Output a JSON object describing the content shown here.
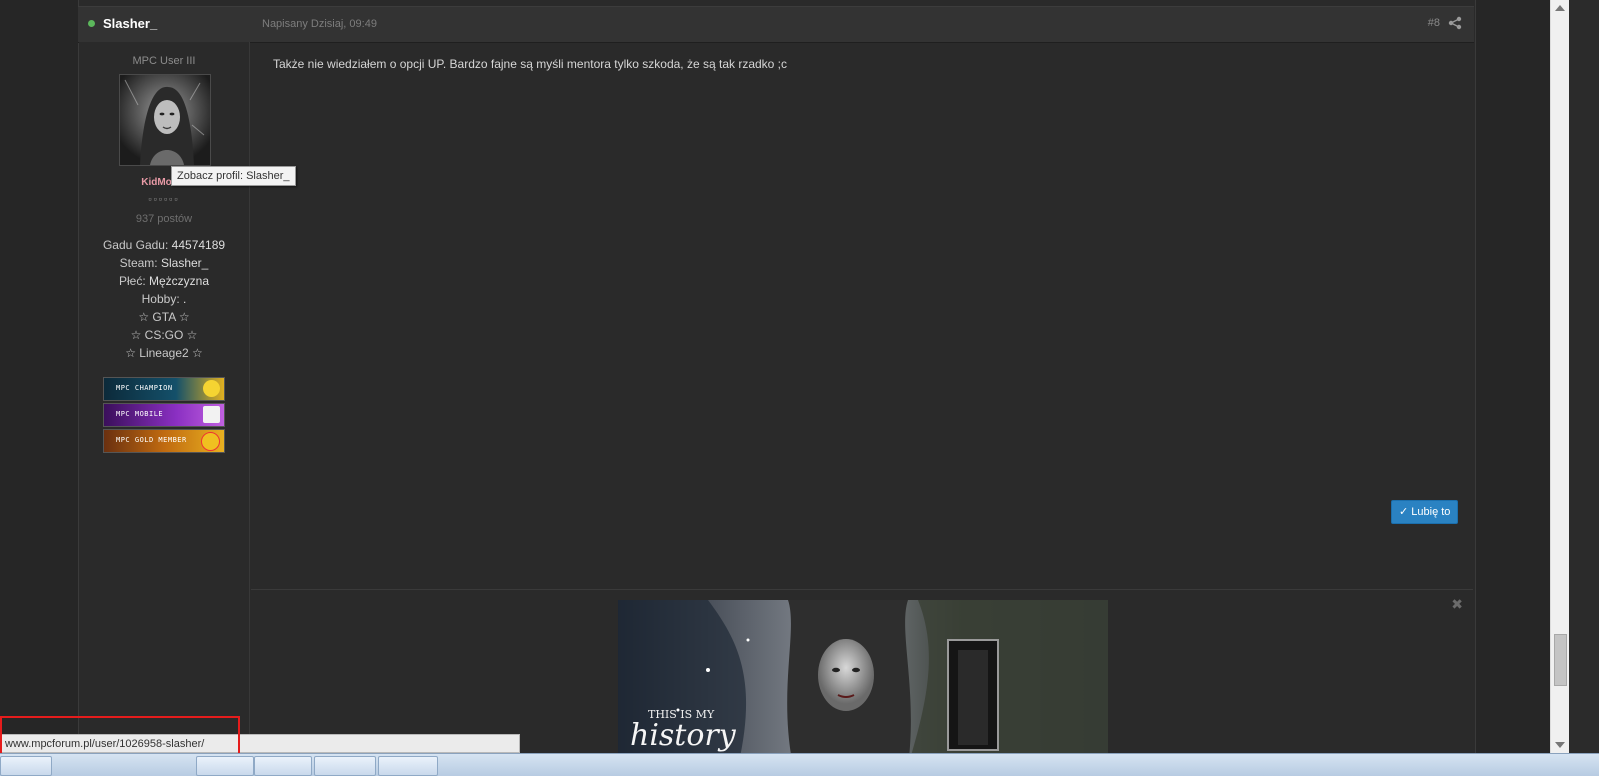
{
  "post": {
    "author": "Slasher_",
    "date": "Napisany Dzisiaj, 09:49",
    "number": "#8",
    "text": "Także nie wiedziałem o opcji UP. Bardzo fajne są myśli mentora tylko szkoda, że są tak rzadko ;c",
    "like_label": "Lubię to"
  },
  "author_pane": {
    "member_title": "MPC User III",
    "group": "KidMod L",
    "pips": "▫▫▫▫▫▫",
    "post_count": "937 postów",
    "fields": {
      "gadu_label": "Gadu Gadu:",
      "gadu_value": "44574189",
      "steam_label": "Steam:",
      "steam_value": "Slasher_",
      "sex_label": "Płeć:",
      "sex_value": "Mężczyzna",
      "hobby_label": "Hobby:",
      "hobby_value": ".",
      "hobby_1": "☆ GTA ☆",
      "hobby_2": "☆ CS:GO ☆",
      "hobby_3": "☆ Lineage2 ☆"
    },
    "awards": [
      "MPC CHAMPION",
      "MPC MOBILE",
      "MPC GOLD MEMBER"
    ]
  },
  "tooltip": "Zobacz profil: Slasher_",
  "signature": {
    "line1": "THIS IS MY",
    "line2": "history"
  },
  "status_bar": {
    "url": "www.mpcforum.pl/user/1026958-slasher/"
  },
  "colors": {
    "accent": "#2a82c2",
    "online": "#5cb85c",
    "group": "#e89aa6",
    "highlight": "#e51c1c"
  }
}
